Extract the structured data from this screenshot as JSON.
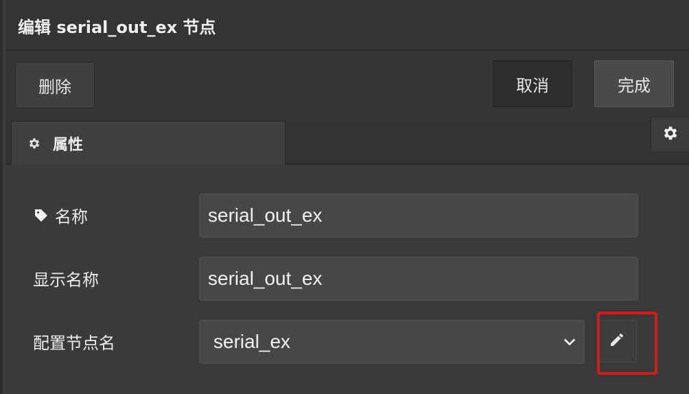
{
  "tray": {
    "title": "编辑 serial_out_ex 节点"
  },
  "toolbar": {
    "delete_label": "删除",
    "cancel_label": "取消",
    "done_label": "完成"
  },
  "tabs": [
    {
      "label": "属性",
      "icon": "gear-icon",
      "active": true
    }
  ],
  "tab_settings_icon": "gear-icon",
  "form": {
    "name": {
      "label": "名称",
      "icon": "tag-icon",
      "value": "serial_out_ex"
    },
    "display_name": {
      "label": "显示名称",
      "value": "serial_out_ex"
    },
    "config_node": {
      "label": "配置节点名",
      "selected": "serial_ex",
      "edit_icon": "pencil-icon"
    }
  },
  "highlight_color": "#d21d1d"
}
